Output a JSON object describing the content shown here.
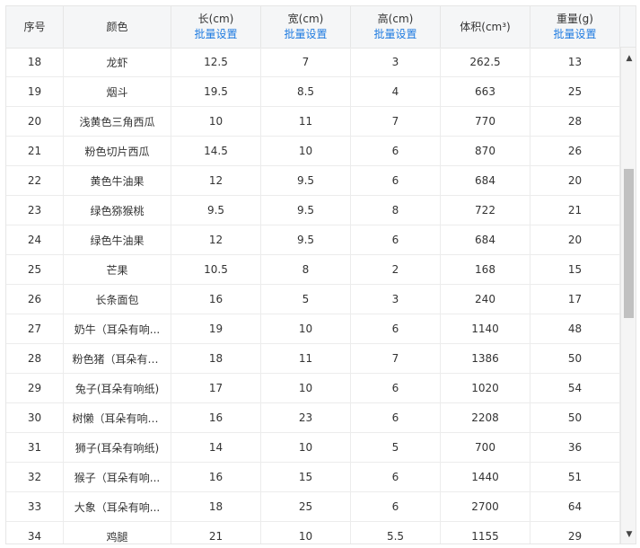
{
  "headers": [
    {
      "title": "序号",
      "action": ""
    },
    {
      "title": "颜色",
      "action": ""
    },
    {
      "title": "长(cm)",
      "action": "批量设置"
    },
    {
      "title": "宽(cm)",
      "action": "批量设置"
    },
    {
      "title": "高(cm)",
      "action": "批量设置"
    },
    {
      "title": "体积(cm³)",
      "action": ""
    },
    {
      "title": "重量(g)",
      "action": "批量设置"
    }
  ],
  "rows": [
    [
      "18",
      "龙虾",
      "12.5",
      "7",
      "3",
      "262.5",
      "13"
    ],
    [
      "19",
      "烟斗",
      "19.5",
      "8.5",
      "4",
      "663",
      "25"
    ],
    [
      "20",
      "浅黄色三角西瓜",
      "10",
      "11",
      "7",
      "770",
      "28"
    ],
    [
      "21",
      "粉色切片西瓜",
      "14.5",
      "10",
      "6",
      "870",
      "26"
    ],
    [
      "22",
      "黄色牛油果",
      "12",
      "9.5",
      "6",
      "684",
      "20"
    ],
    [
      "23",
      "绿色猕猴桃",
      "9.5",
      "9.5",
      "8",
      "722",
      "21"
    ],
    [
      "24",
      "绿色牛油果",
      "12",
      "9.5",
      "6",
      "684",
      "20"
    ],
    [
      "25",
      "芒果",
      "10.5",
      "8",
      "2",
      "168",
      "15"
    ],
    [
      "26",
      "长条面包",
      "16",
      "5",
      "3",
      "240",
      "17"
    ],
    [
      "27",
      "奶牛（耳朵有响...",
      "19",
      "10",
      "6",
      "1140",
      "48"
    ],
    [
      "28",
      "粉色猪（耳朵有响...",
      "18",
      "11",
      "7",
      "1386",
      "50"
    ],
    [
      "29",
      "兔子(耳朵有响纸)",
      "17",
      "10",
      "6",
      "1020",
      "54"
    ],
    [
      "30",
      "树懒（耳朵有响纸)",
      "16",
      "23",
      "6",
      "2208",
      "50"
    ],
    [
      "31",
      "狮子(耳朵有响纸)",
      "14",
      "10",
      "5",
      "700",
      "36"
    ],
    [
      "32",
      "猴子（耳朵有响...",
      "16",
      "15",
      "6",
      "1440",
      "51"
    ],
    [
      "33",
      "大象（耳朵有响...",
      "18",
      "25",
      "6",
      "2700",
      "64"
    ],
    [
      "34",
      "鸡腿",
      "21",
      "10",
      "5.5",
      "1155",
      "29"
    ]
  ],
  "scroll": {
    "up_icon": "▲",
    "down_icon": "▼",
    "position": 0.33
  }
}
